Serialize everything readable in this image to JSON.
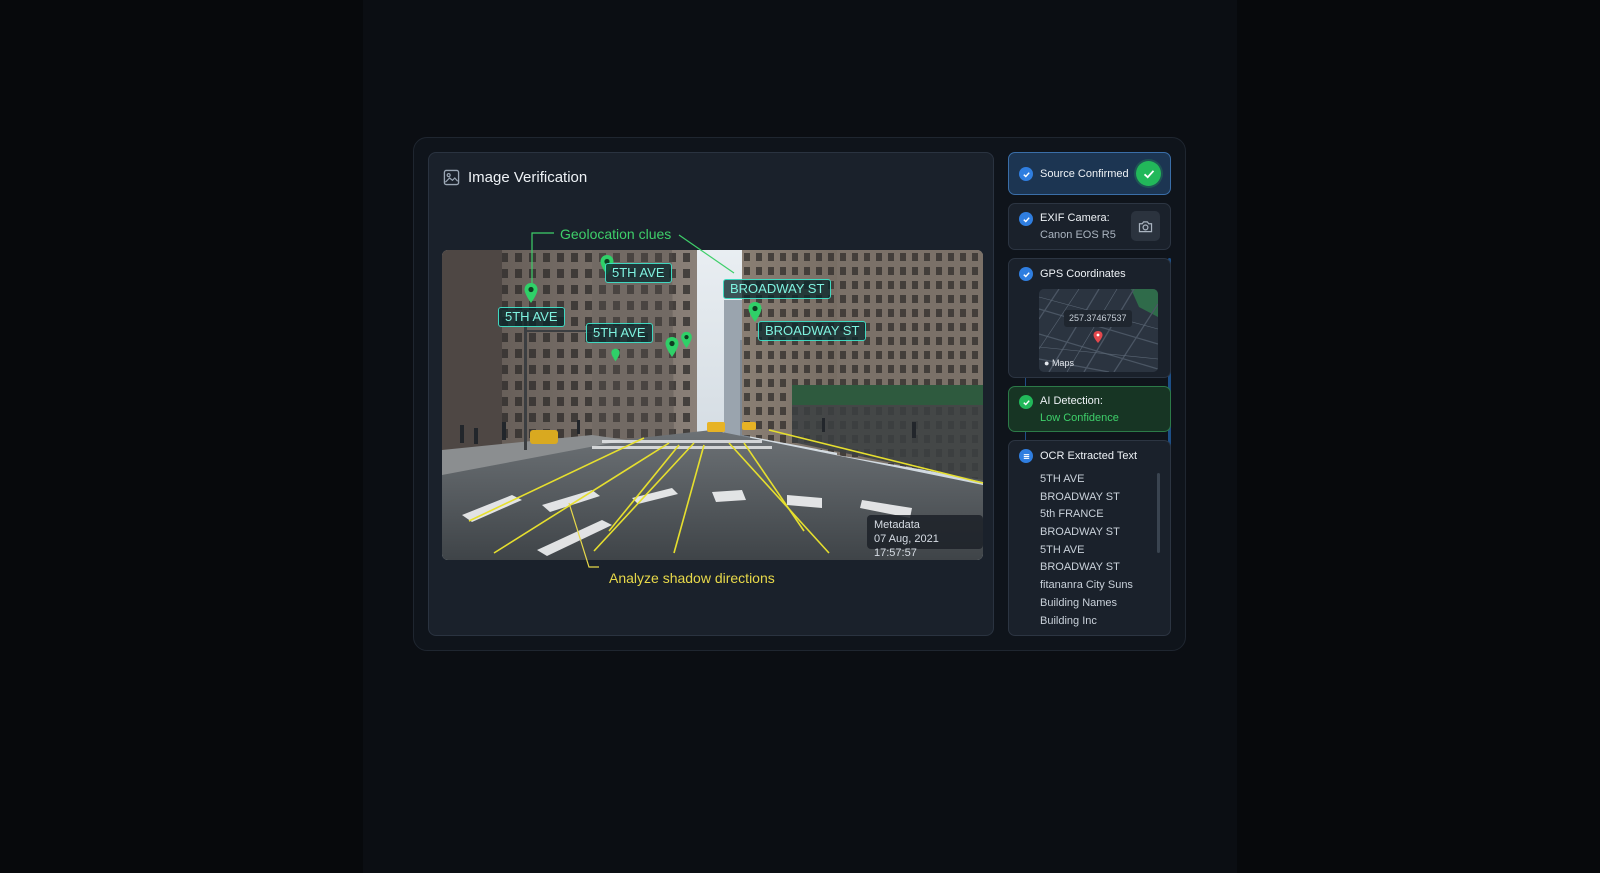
{
  "panel": {
    "title": "Image Verification"
  },
  "photo": {
    "callouts": {
      "geolocation": "Geolocation clues",
      "shadows": "Analyze shadow directions"
    },
    "tags": {
      "tag1": "5TH AVE",
      "tag2": "5TH AVE",
      "tag3": "5TH AVE",
      "tag4": "BROADWAY ST",
      "tag5": "BROADWAY ST"
    },
    "metadata": {
      "label": "Metadata",
      "timestamp": "07 Aug, 2021 17:57:57"
    }
  },
  "sidebar": {
    "source": {
      "label": "Source Confirmed"
    },
    "exif": {
      "label": "EXIF Camera:",
      "value": "Canon EOS R5"
    },
    "gps": {
      "label": "GPS Coordinates",
      "coordinate": "257.37467537",
      "map_brand": "Maps"
    },
    "ai": {
      "label": "AI Detection:",
      "value": "Low Confidence"
    },
    "ocr": {
      "label": "OCR Extracted Text",
      "items": [
        "5TH AVE",
        "BROADWAY ST",
        "5th FRANCE",
        "BROADWAY ST",
        "5TH AVE",
        "BROADWAY ST",
        "fitananra City Suns",
        "Building Names",
        "Building Inc"
      ]
    }
  },
  "colors": {
    "accent_blue": "#2f7ee0",
    "confirm_green": "#22b85a",
    "tag_teal": "#3fd8c0",
    "shadow_yellow": "#e8d94a",
    "callout_green": "#3ecf6a"
  },
  "icons": {
    "header": "image-icon",
    "check": "check-circle-icon",
    "camera": "camera-icon",
    "pin": "map-pin-icon",
    "ocr": "text-lines-icon"
  }
}
